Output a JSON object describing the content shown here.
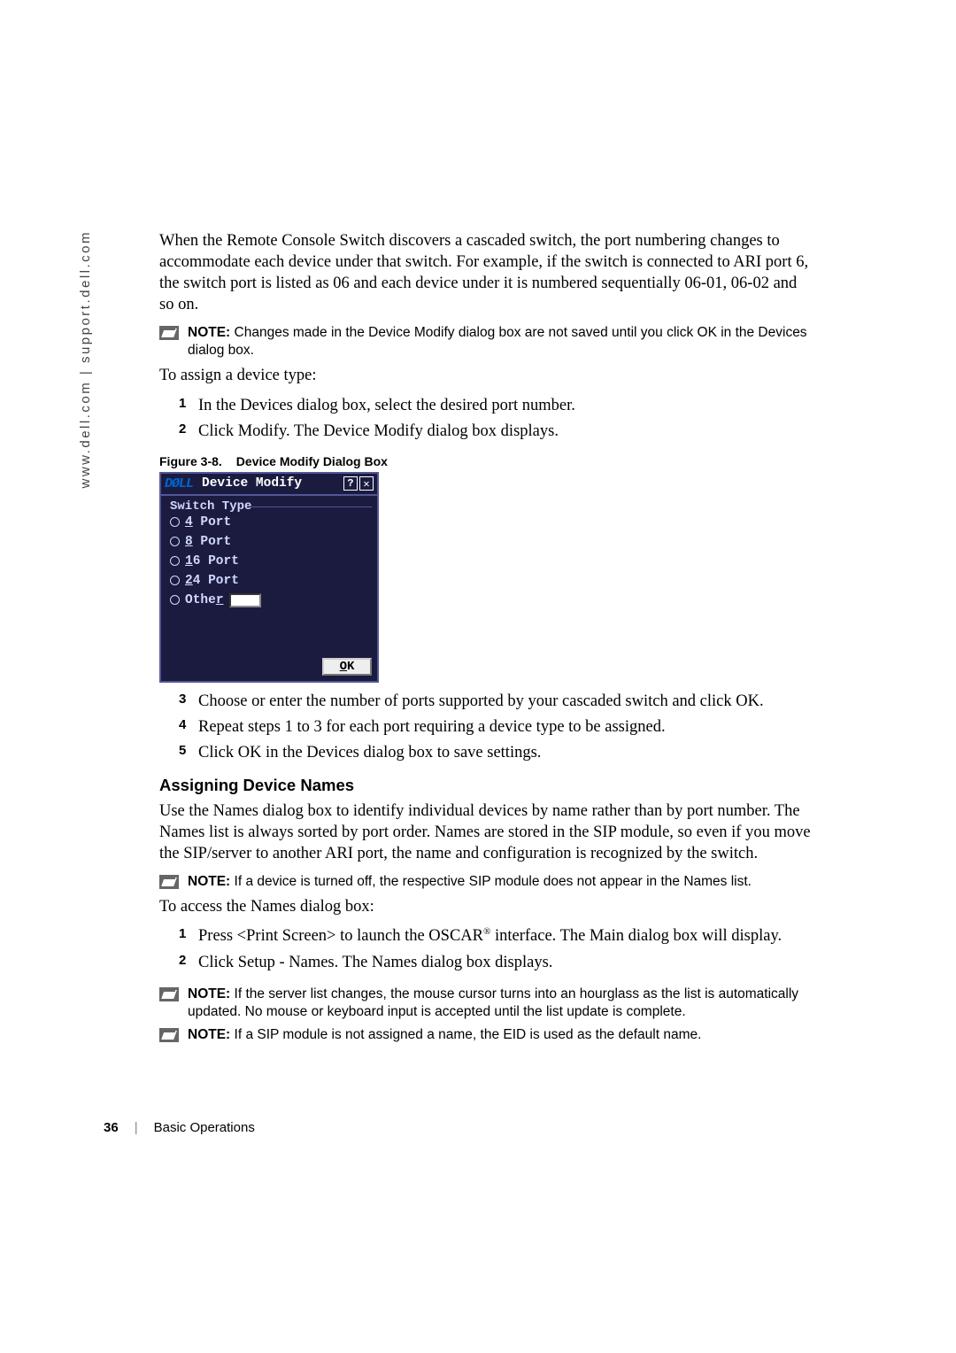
{
  "sidebar": {
    "url": "www.dell.com | support.dell.com"
  },
  "para1": "When the Remote Console Switch discovers a cascaded switch, the port numbering changes to accommodate each device under that switch. For example, if the switch is connected to ARI port 6, the switch port is listed as 06 and each device under it is numbered sequentially 06-01, 06-02 and so on.",
  "notes": {
    "n1_prefix": "NOTE:",
    "n1": " Changes made in the Device Modify dialog box are not saved until you click OK in the Devices dialog box.",
    "n2_prefix": "NOTE:",
    "n2": " If a device is turned off, the respective SIP module does not appear in the Names list.",
    "n3_prefix": "NOTE:",
    "n3": " If the server list changes, the mouse cursor turns into an hourglass as the list is automatically updated. No mouse or keyboard input is accepted until the list update is complete.",
    "n4_prefix": "NOTE:",
    "n4": "  If a SIP module is not assigned a name, the EID is used as the default name."
  },
  "para2": "To assign a device type:",
  "list1": {
    "i1_n": "1",
    "i1": "In the Devices dialog box, select the desired port number.",
    "i2_n": "2",
    "i2": "Click Modify. The Device Modify dialog box displays."
  },
  "fig": {
    "num": "Figure 3-8.",
    "title": "Device Modify Dialog Box"
  },
  "dialog": {
    "logo": "DØLL",
    "title": "Device Modify",
    "help": "?",
    "close": "✕",
    "group": "Switch Type",
    "opts": {
      "p4_u": "4",
      "p4": " Port",
      "p8_u": "8",
      "p8": " Port",
      "p16_u": "1",
      "p16_r": "6 Port",
      "p24_u": "2",
      "p24_r": "4 Port",
      "other_pre": "Othe",
      "other_u": "r"
    },
    "ok_u": "O",
    "ok_r": "K"
  },
  "list2": {
    "i3_n": "3",
    "i3": "Choose or enter the number of ports supported by your cascaded switch and click OK.",
    "i4_n": "4",
    "i4": "Repeat steps 1 to 3 for each port requiring a device type to be assigned.",
    "i5_n": "5",
    "i5": "Click OK in the Devices dialog box to save settings."
  },
  "section": "Assigning Device Names",
  "para3": "Use the Names dialog box to identify individual devices by name rather than by port number. The Names list is always sorted by port order. Names are stored in the SIP module, so even if you move the SIP/server to another ARI port, the name and configuration is recognized by the switch.",
  "para4": "To access the Names dialog box:",
  "list3": {
    "i1_n": "1",
    "i1a": "Press <Print Screen> to launch the OSCAR",
    "reg": "®",
    "i1b": " interface. The Main dialog box will display.",
    "i2_n": "2",
    "i2": "Click Setup - Names. The Names dialog box displays."
  },
  "footer": {
    "page": "36",
    "divider": "|",
    "section": "Basic Operations"
  }
}
